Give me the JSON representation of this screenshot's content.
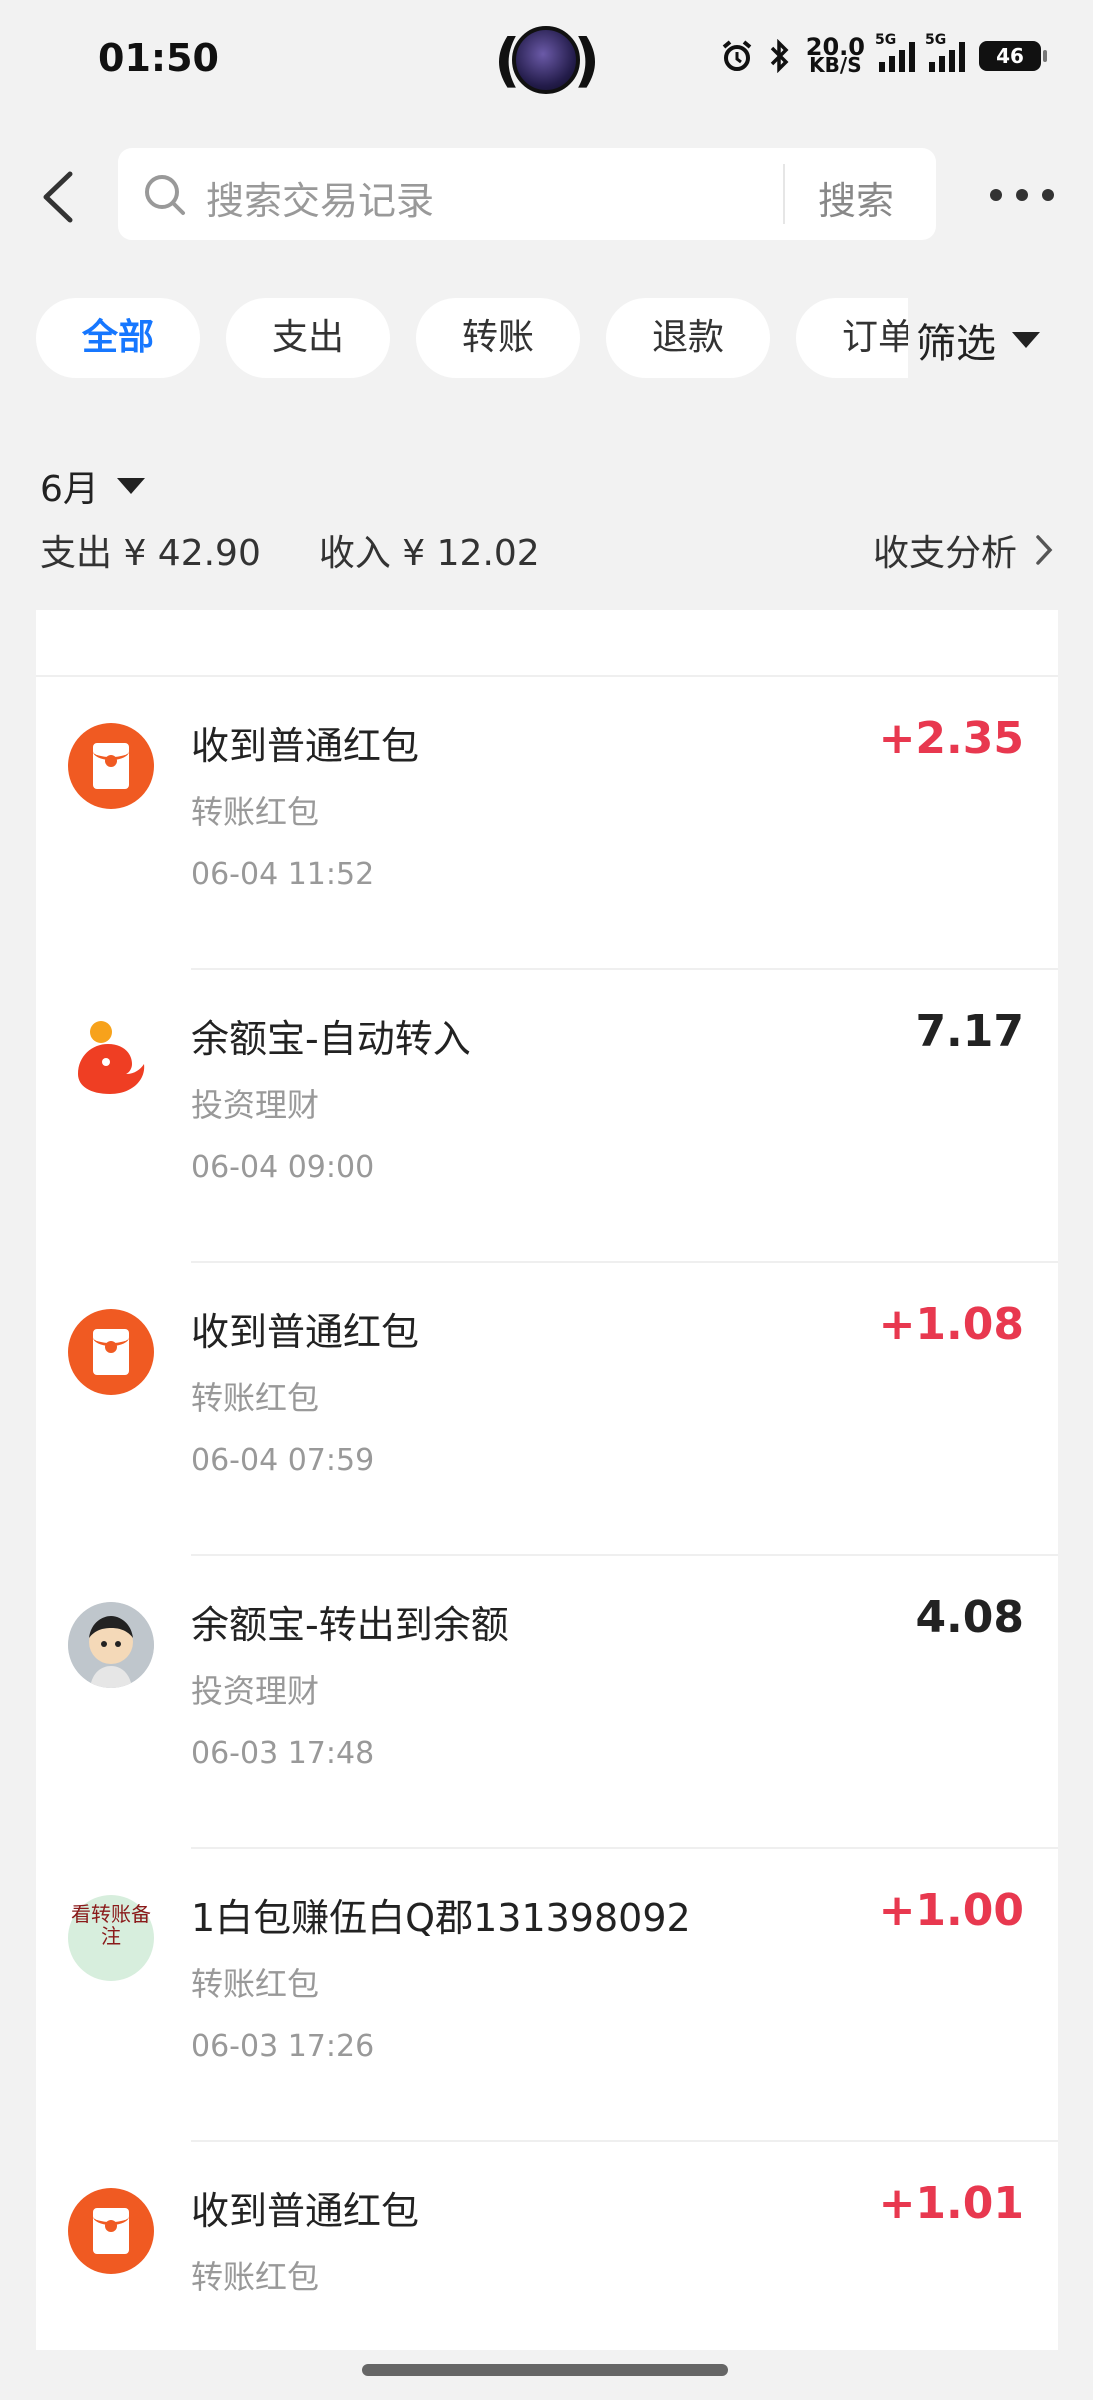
{
  "status_bar": {
    "time": "01:50",
    "speed_value": "20.0",
    "speed_unit": "KB/S",
    "net1": "5G",
    "net2": "5G",
    "battery": "46"
  },
  "search": {
    "placeholder": "搜索交易记录",
    "button": "搜索"
  },
  "filters": {
    "chips": [
      "全部",
      "支出",
      "转账",
      "退款",
      "订单"
    ],
    "active_index": 0,
    "filter_label": "筛选"
  },
  "summary": {
    "month": "6月",
    "expense": "支出 ¥ 42.90",
    "income": "收入 ¥ 12.02",
    "analysis": "收支分析"
  },
  "transactions": [
    {
      "title": "收到普通红包",
      "category": "转账红包",
      "time": "06-04 11:52",
      "amount": "+2.35",
      "type": "income",
      "icon": "red-packet-icon"
    },
    {
      "title": "余额宝-自动转入",
      "category": "投资理财",
      "time": "06-04 09:00",
      "amount": "7.17",
      "type": "neutral",
      "icon": "yuebao-icon"
    },
    {
      "title": "收到普通红包",
      "category": "转账红包",
      "time": "06-04 07:59",
      "amount": "+1.08",
      "type": "income",
      "icon": "red-packet-icon"
    },
    {
      "title": "余额宝-转出到余额",
      "category": "投资理财",
      "time": "06-03 17:48",
      "amount": "4.08",
      "type": "neutral",
      "icon": "user-avatar"
    },
    {
      "title": "1白包赚伍白Q郡131398092",
      "category": "转账红包",
      "time": "06-03 17:26",
      "amount": "+1.00",
      "type": "income",
      "icon": "text-avatar",
      "avatar_text": "看转账备注"
    },
    {
      "title": "收到普通红包",
      "category": "转账红包",
      "time": "",
      "amount": "+1.01",
      "type": "income",
      "icon": "red-packet-icon"
    }
  ],
  "colors": {
    "accent": "#1677ff",
    "income": "#e8384f",
    "red_packet": "#f05a22"
  }
}
